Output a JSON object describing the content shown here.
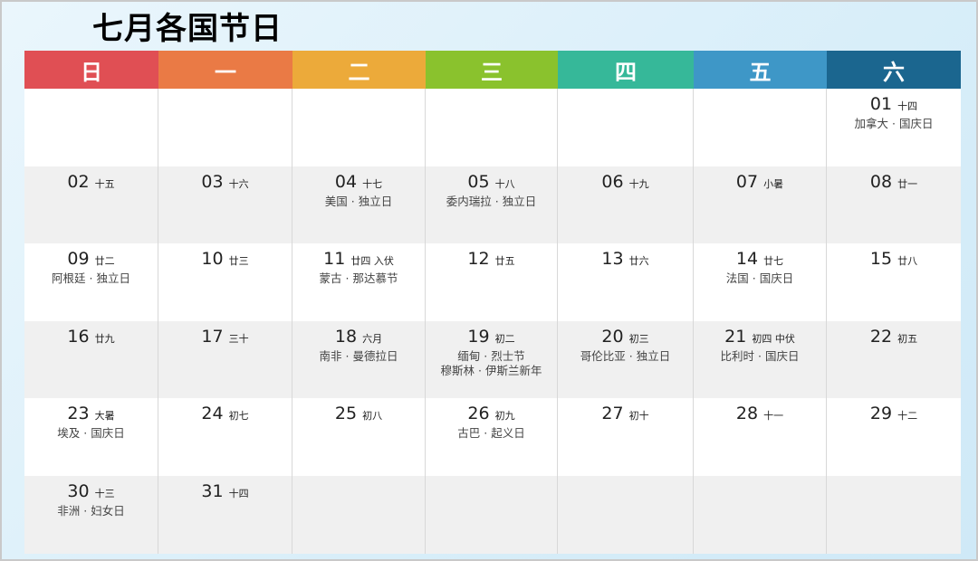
{
  "title": "七月各国节日",
  "weekdays": [
    {
      "label": "日",
      "color": "#e04f54"
    },
    {
      "label": "一",
      "color": "#ea7a45"
    },
    {
      "label": "二",
      "color": "#ecaa3a"
    },
    {
      "label": "三",
      "color": "#8ac22d"
    },
    {
      "label": "四",
      "color": "#36b899"
    },
    {
      "label": "五",
      "color": "#3e97c7"
    },
    {
      "label": "六",
      "color": "#1b668f"
    }
  ],
  "days": [
    {
      "day": "01",
      "lunar": "十四",
      "holidays": [
        "加拿大 · 国庆日"
      ]
    },
    {
      "day": "02",
      "lunar": "十五",
      "holidays": []
    },
    {
      "day": "03",
      "lunar": "十六",
      "holidays": []
    },
    {
      "day": "04",
      "lunar": "十七",
      "holidays": [
        "美国 · 独立日"
      ]
    },
    {
      "day": "05",
      "lunar": "十八",
      "holidays": [
        "委内瑞拉 · 独立日"
      ]
    },
    {
      "day": "06",
      "lunar": "十九",
      "holidays": []
    },
    {
      "day": "07",
      "lunar": "小暑",
      "holidays": []
    },
    {
      "day": "08",
      "lunar": "廿一",
      "holidays": []
    },
    {
      "day": "09",
      "lunar": "廿二",
      "holidays": [
        "阿根廷 · 独立日"
      ]
    },
    {
      "day": "10",
      "lunar": "廿三",
      "holidays": []
    },
    {
      "day": "11",
      "lunar": "廿四 入伏",
      "holidays": [
        "蒙古 · 那达慕节"
      ]
    },
    {
      "day": "12",
      "lunar": "廿五",
      "holidays": []
    },
    {
      "day": "13",
      "lunar": "廿六",
      "holidays": []
    },
    {
      "day": "14",
      "lunar": "廿七",
      "holidays": [
        "法国 · 国庆日"
      ]
    },
    {
      "day": "15",
      "lunar": "廿八",
      "holidays": []
    },
    {
      "day": "16",
      "lunar": "廿九",
      "holidays": []
    },
    {
      "day": "17",
      "lunar": "三十",
      "holidays": []
    },
    {
      "day": "18",
      "lunar": "六月",
      "holidays": [
        "南非 · 曼德拉日"
      ]
    },
    {
      "day": "19",
      "lunar": "初二",
      "holidays": [
        "缅甸 · 烈士节",
        "穆斯林 · 伊斯兰新年"
      ]
    },
    {
      "day": "20",
      "lunar": "初三",
      "holidays": [
        "哥伦比亚 · 独立日"
      ]
    },
    {
      "day": "21",
      "lunar": "初四 中伏",
      "holidays": [
        "比利时 · 国庆日"
      ]
    },
    {
      "day": "22",
      "lunar": "初五",
      "holidays": []
    },
    {
      "day": "23",
      "lunar": "大暑",
      "holidays": [
        "埃及 · 国庆日"
      ]
    },
    {
      "day": "24",
      "lunar": "初七",
      "holidays": []
    },
    {
      "day": "25",
      "lunar": "初八",
      "holidays": []
    },
    {
      "day": "26",
      "lunar": "初九",
      "holidays": [
        "古巴 · 起义日"
      ]
    },
    {
      "day": "27",
      "lunar": "初十",
      "holidays": []
    },
    {
      "day": "28",
      "lunar": "十一",
      "holidays": []
    },
    {
      "day": "29",
      "lunar": "十二",
      "holidays": []
    },
    {
      "day": "30",
      "lunar": "十三",
      "holidays": [
        "非洲 · 妇女日"
      ]
    },
    {
      "day": "31",
      "lunar": "十四",
      "holidays": []
    }
  ]
}
